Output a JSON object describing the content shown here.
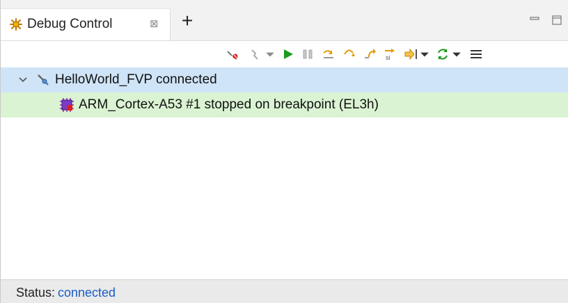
{
  "view": {
    "tab_title": "Debug Control",
    "tab_close_glyph": "⊠",
    "add_tab_glyph": "+"
  },
  "toolbar": {
    "icons": [
      "disconnect-icon",
      "remove-connection-icon",
      "dropdown-icon",
      "continue-icon",
      "interrupt-icon",
      "step-over-icon",
      "step-into-icon",
      "step-out-icon",
      "step-instruction-icon",
      "run-to-selection-icon",
      "dropdown-icon",
      "refresh-icon",
      "dropdown-icon",
      "view-menu-icon"
    ]
  },
  "tree": {
    "rows": [
      {
        "label": "HelloWorld_FVP connected",
        "icon": "target-connection-icon",
        "expanded": true
      },
      {
        "label": "ARM_Cortex-A53 #1 stopped on breakpoint (EL3h)",
        "icon": "core-chip-icon"
      }
    ]
  },
  "status": {
    "label": "Status:",
    "value": "connected"
  },
  "colors": {
    "row_selected": "#cfe4f7",
    "row_stopped": "#daf3d2",
    "status_link": "#1a5cc8",
    "run_green": "#1c9a1c",
    "accent_orange": "#e39b00"
  }
}
